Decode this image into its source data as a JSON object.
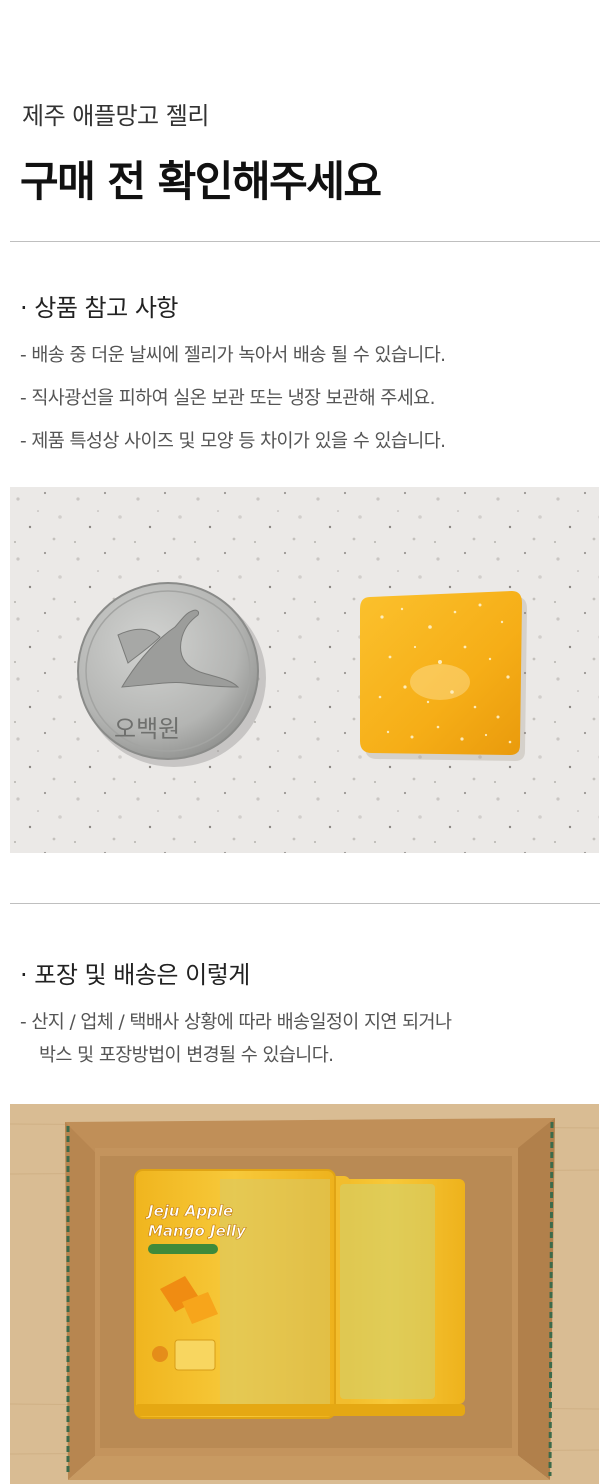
{
  "header": {
    "subtitle": "제주 애플망고 젤리",
    "title": "구매 전 확인해주세요"
  },
  "section_reference": {
    "heading": "· 상품 참고 사항",
    "notes": [
      "- 배송 중 더운 날씨에 젤리가 녹아서 배송 될 수 있습니다.",
      "- 직사광선을 피하여 실온 보관 또는 냉장 보관해 주세요.",
      "- 제품 특성상 사이즈 및 모양 등 차이가 있을 수 있습니다."
    ]
  },
  "photo_size_compare": {
    "coin_text": "오백원",
    "colors": {
      "jelly": "#f7b31c",
      "coin": "#b7b8b6",
      "counter": "#ebe9e7"
    }
  },
  "section_packaging": {
    "heading": "· 포장 및 배송은 이렇게",
    "notes": [
      "- 산지 / 업체 / 택배사 상황에 따라 배송일정이 지연 되거나",
      "박스 및 포장방법이 변경될 수 있습니다."
    ]
  },
  "photo_box": {
    "pack_brand_line1": "Jeju Apple",
    "pack_brand_line2": "Mango Jelly",
    "colors": {
      "pack": "#f4c12a",
      "box": "#c89a62",
      "floor": "#d6b88e"
    }
  }
}
